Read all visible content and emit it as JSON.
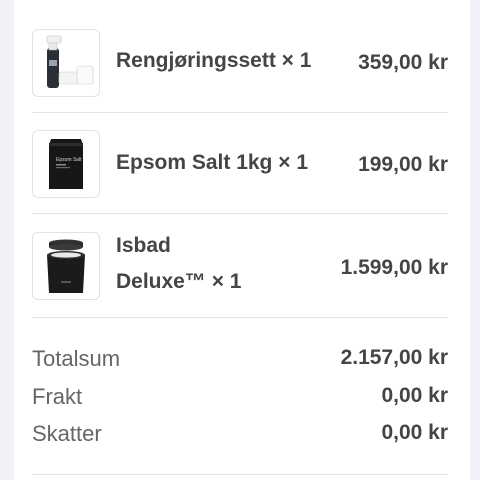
{
  "cart": {
    "items": [
      {
        "name": "Rengjøringssett × 1",
        "price": "359,00 kr",
        "image_icon": "cleaning-kit-icon"
      },
      {
        "name": "Epsom Salt 1kg × 1",
        "price": "199,00 kr",
        "image_icon": "salt-bag-icon",
        "bag_text": "Epsom Salt"
      },
      {
        "name_line1": "Isbad",
        "name_line2": "Deluxe™ × 1",
        "price": "1.599,00 kr",
        "image_icon": "ice-bath-tub-icon"
      }
    ]
  },
  "summary": {
    "total_label": "Totalsum",
    "total_value": "2.157,00 kr",
    "shipping_label": "Frakt",
    "shipping_value": "0,00 kr",
    "tax_label": "Skatter",
    "tax_value": "0,00 kr"
  }
}
